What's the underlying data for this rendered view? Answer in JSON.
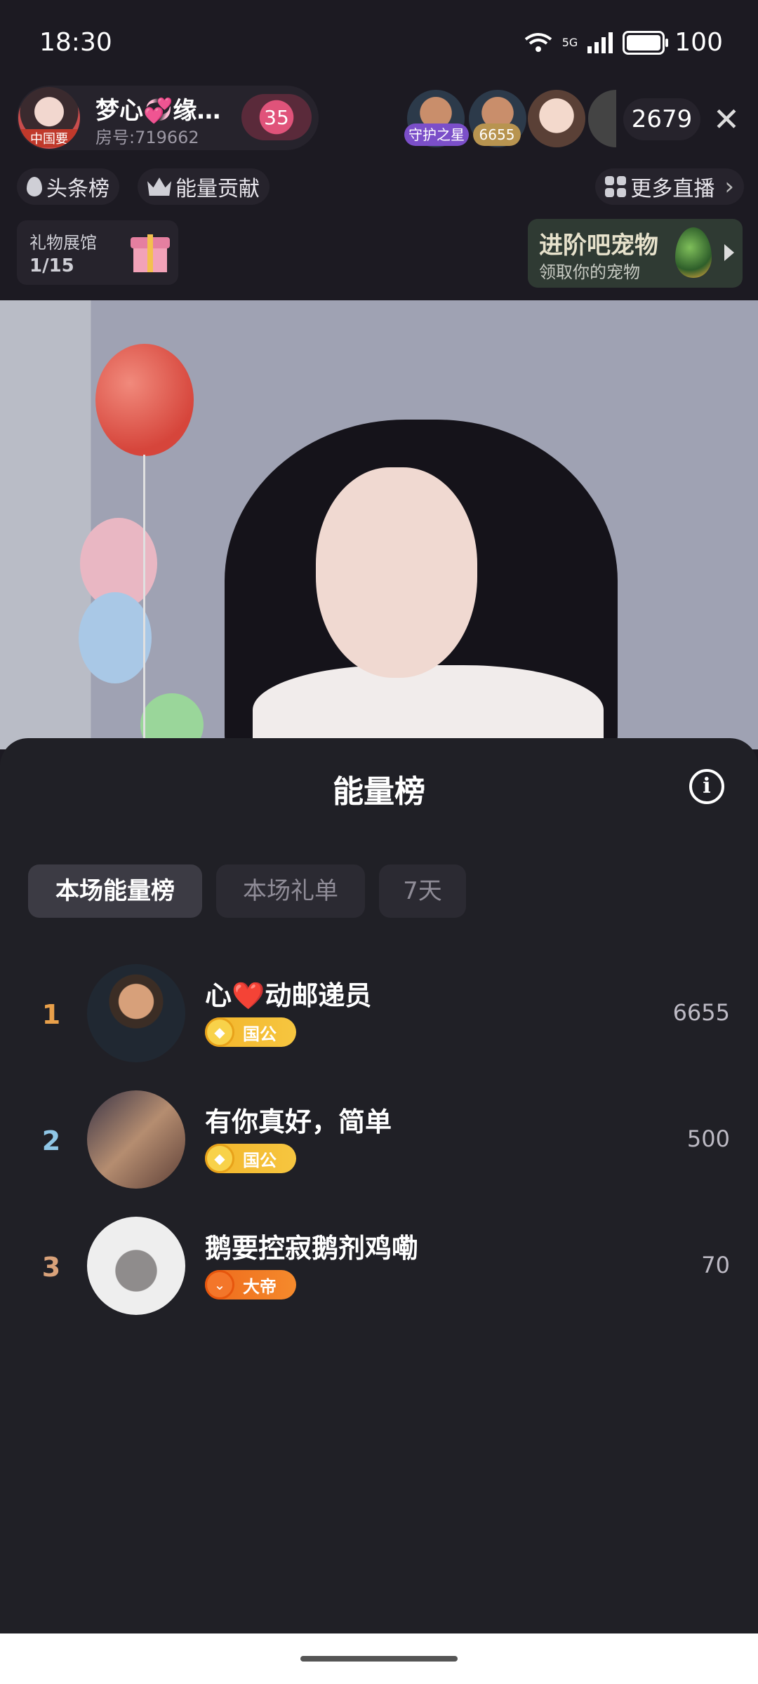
{
  "status_bar": {
    "time": "18:30",
    "network": "5G",
    "battery": "100"
  },
  "host": {
    "name": "梦心💞缘…",
    "room": "房号:719662",
    "avatar_caption": "中国要",
    "heart_level": "35"
  },
  "viewers": {
    "badge1": "守护之星",
    "badge2": "6655",
    "count": "2679",
    "close": "✕"
  },
  "chips": {
    "headline": "头条榜",
    "energy": "能量贡献",
    "more_live": "更多直播"
  },
  "gift_hall": {
    "title": "礼物展馆",
    "progress": "1/15"
  },
  "pet_banner": {
    "title": "进阶吧宠物",
    "subtitle": "领取你的宠物"
  },
  "sheet": {
    "title": "能量榜",
    "info_icon": "i",
    "tabs": [
      {
        "label": "本场能量榜",
        "active": true
      },
      {
        "label": "本场礼单",
        "active": false
      },
      {
        "label": "7天",
        "active": false
      }
    ]
  },
  "leaderboard": [
    {
      "rank": "1",
      "rank_color": "#e9a04a",
      "name": "心❤️动邮递员",
      "badge": "国公",
      "badge_color": "#f3b52a",
      "score": "6655"
    },
    {
      "rank": "2",
      "rank_color": "#8fc6e6",
      "name": "有你真好，简单",
      "badge": "国公",
      "badge_color": "#f3b52a",
      "score": "500"
    },
    {
      "rank": "3",
      "rank_color": "#d9a27a",
      "name": "鹅要控寂鹅剂鸡嘞",
      "badge": "大帝",
      "badge_color": "#ee6a1c",
      "score": "70"
    }
  ],
  "icons": [
    "wifi-icon",
    "signal-icon",
    "battery-icon",
    "drop-icon",
    "crown-icon",
    "grid-icon",
    "chevron-right-icon",
    "gift-icon",
    "egg-icon",
    "info-icon",
    "close-icon"
  ]
}
